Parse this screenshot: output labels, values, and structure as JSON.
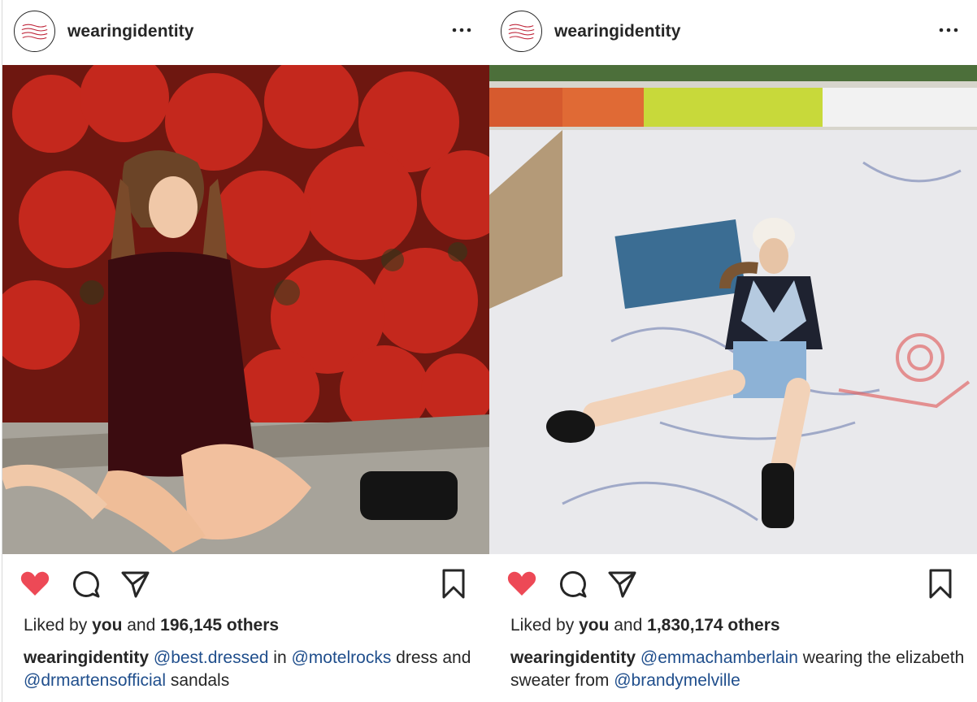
{
  "posts": [
    {
      "username": "wearingidentity",
      "likes": {
        "prefix": "Liked by",
        "you": "you",
        "and": "and",
        "count": "196,145 others"
      },
      "caption": {
        "author": "wearingidentity",
        "mention1": "@best.dressed",
        "text1": "in",
        "mention2": "@motelrocks",
        "text2": "dress and",
        "mention3": "@drmartensofficial",
        "text3": "sandals"
      },
      "photo": "woman in red floral dress sitting in front of red bougainvillea"
    },
    {
      "username": "wearingidentity",
      "likes": {
        "prefix": "Liked by",
        "you": "you",
        "and": "and",
        "count": "1,830,174 others"
      },
      "caption": {
        "author": "wearingidentity",
        "mention1": "@emmachamberlain",
        "text1": "wearing the elizabeth sweater from",
        "mention2": "@brandymelville"
      },
      "photo": "woman in argyle sweater sitting in graffiti skate bowl"
    }
  ],
  "icons": {
    "like": "heart-icon",
    "comment": "comment-icon",
    "share": "share-icon",
    "save": "bookmark-icon",
    "more": "more-icon"
  },
  "colors": {
    "like_red": "#ed4956",
    "link_blue": "#1f4e8c",
    "text": "#262626"
  }
}
